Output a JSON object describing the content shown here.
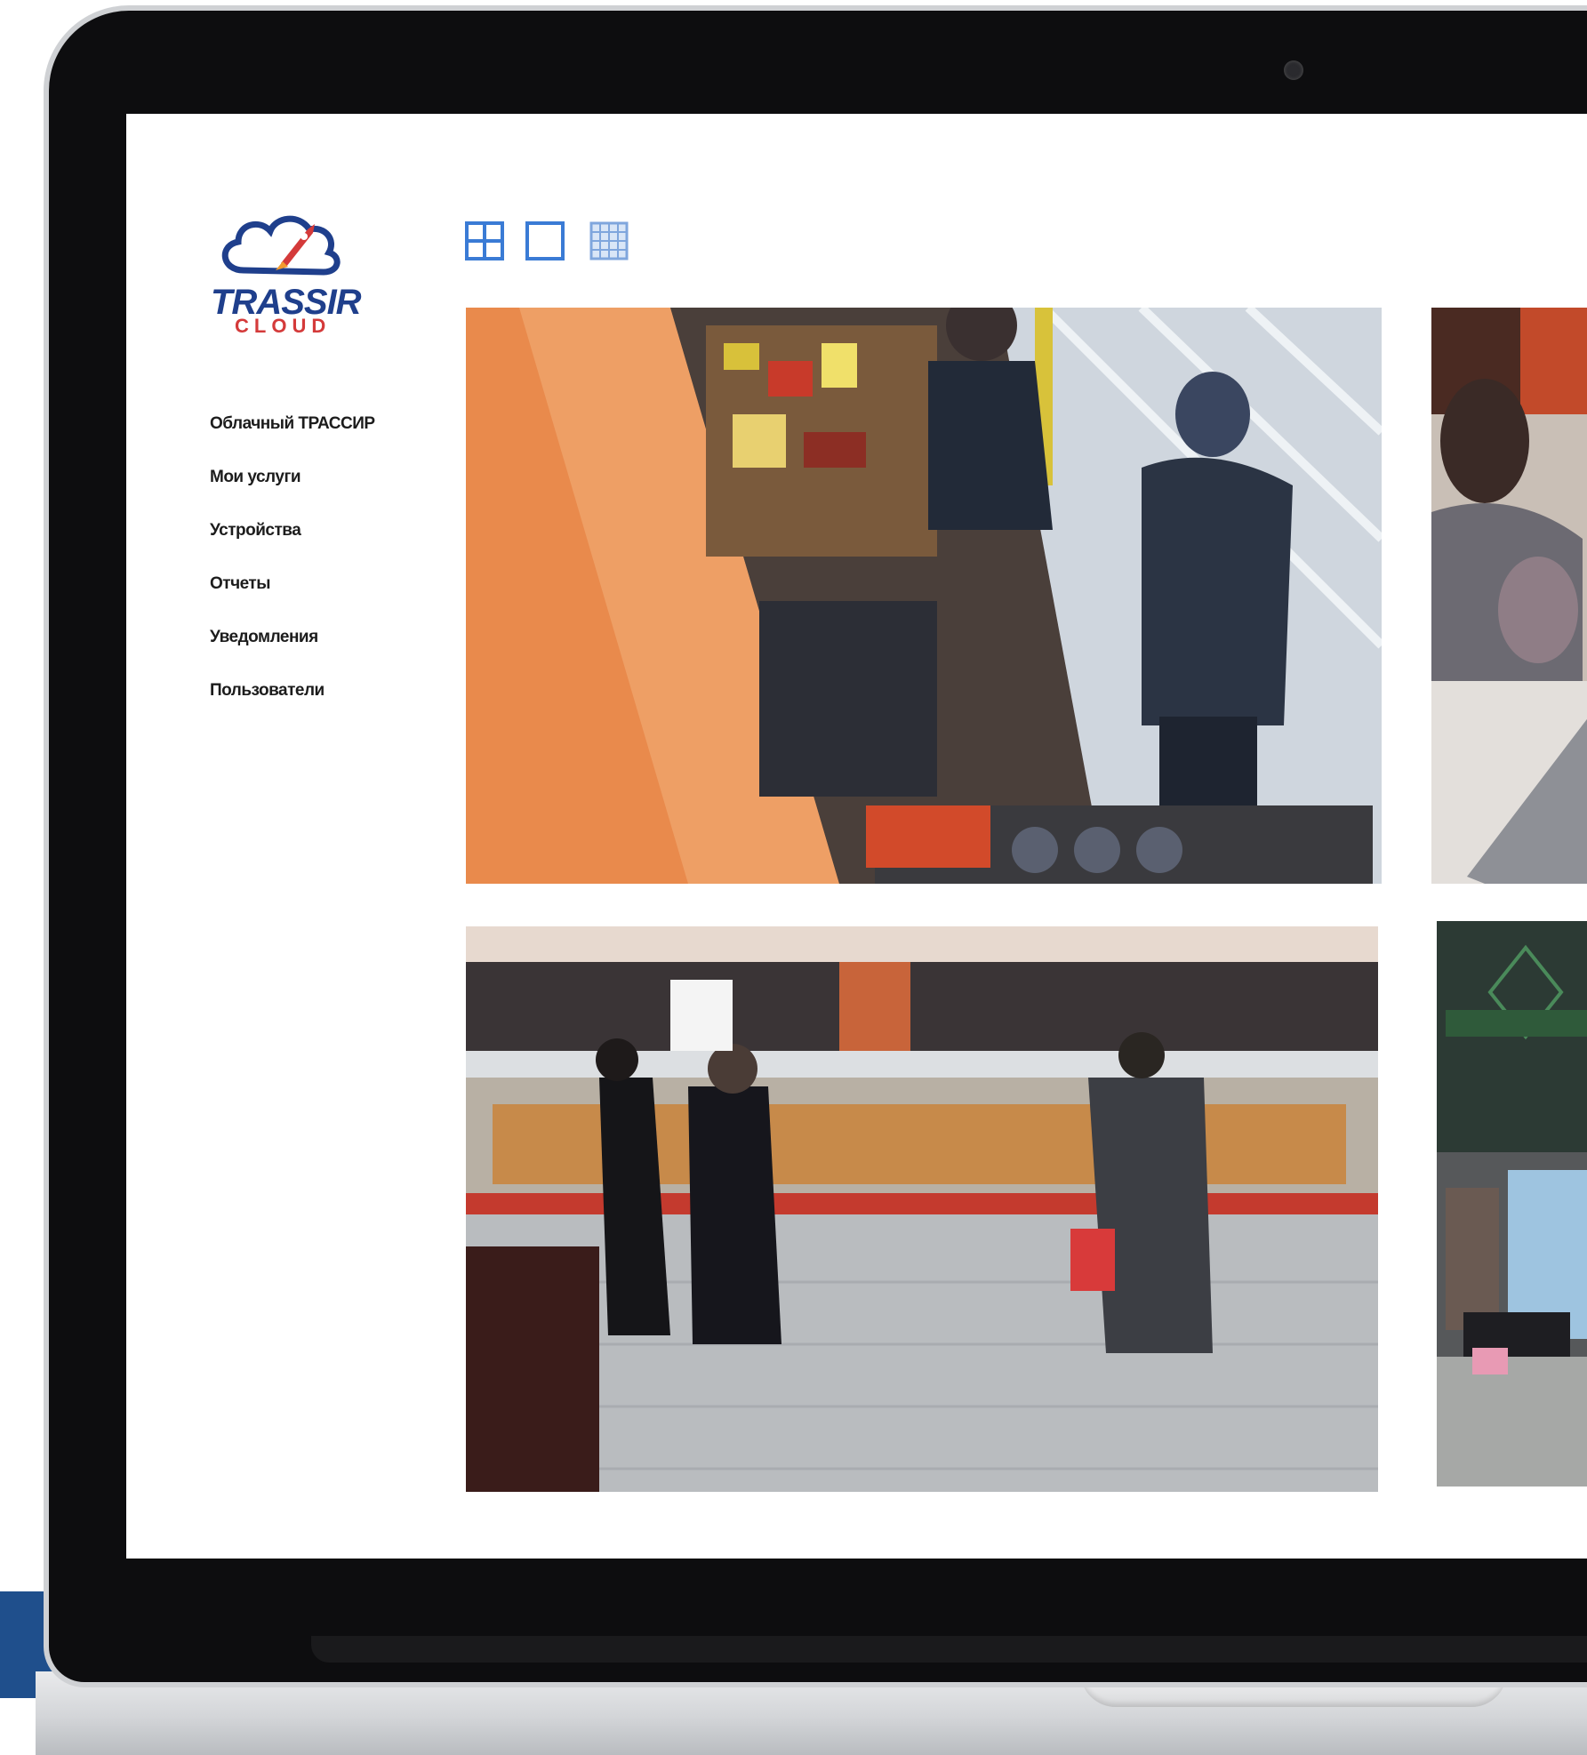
{
  "app": {
    "logo_name": "TRASSIR",
    "logo_sub": "CLOUD"
  },
  "sidebar": {
    "items": [
      {
        "label": "Облачный ТРАССИР"
      },
      {
        "label": "Мои услуги"
      },
      {
        "label": "Устройства"
      },
      {
        "label": "Отчеты"
      },
      {
        "label": "Уведомления"
      },
      {
        "label": "Пользователи"
      }
    ]
  },
  "toolbar": {
    "views": [
      {
        "icon": "grid-2x2-icon"
      },
      {
        "icon": "single-view-icon"
      },
      {
        "icon": "grid-4x4-icon"
      }
    ]
  },
  "colors": {
    "accent": "#3a7bd5",
    "brand_blue": "#1f3f8c",
    "brand_red": "#d43a3a"
  },
  "cameras": [
    {
      "icon": "camera-feed-store-shelves"
    },
    {
      "icon": "camera-feed-woman-at-counter"
    },
    {
      "icon": "camera-feed-deli-counter"
    },
    {
      "icon": "camera-feed-store-entrance"
    }
  ]
}
